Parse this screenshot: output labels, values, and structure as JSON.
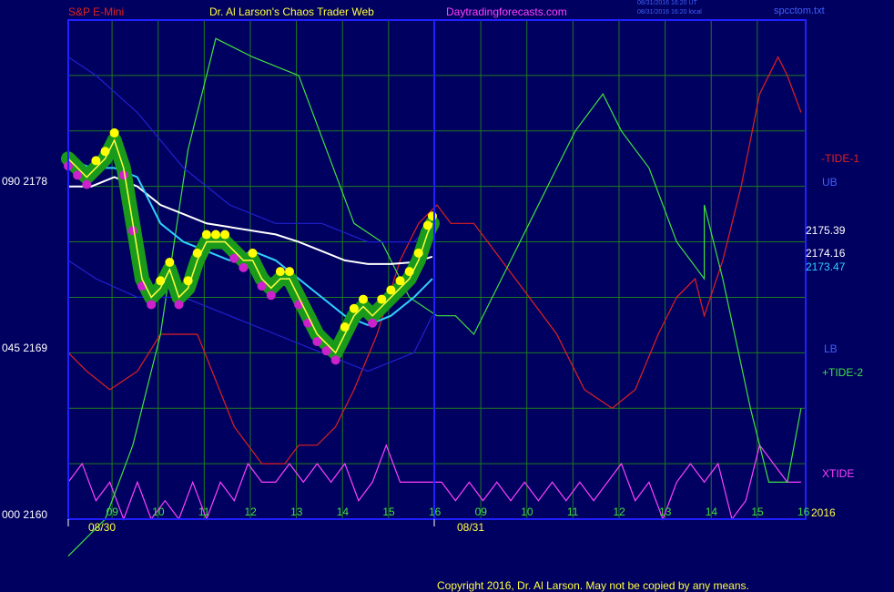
{
  "header": {
    "instrument": "S&P E-Mini",
    "site_title": "Dr. Al Larson's Chaos Trader Web",
    "site_url": "Daytradingforecasts.com",
    "timestamp_ut": "08/31/2016 16:20 UT",
    "timestamp_local": "08/31/2016 16:20 local",
    "file": "spcctom.txt"
  },
  "footer": {
    "copyright": "Copyright 2016, Dr. Al Larson. May not be copied by any means."
  },
  "colors": {
    "background": "#000060",
    "grid": "#1f7a1f",
    "frame": "#2020ff",
    "price": "#ffff40",
    "tide1": "#e02020",
    "tide2": "#40e040",
    "xtide": "#ff40ff",
    "band": "#2020d0",
    "avg_white": "#ffffff",
    "avg_cyan": "#30d0ff"
  },
  "chart_data": {
    "type": "line",
    "ylim": [
      2160,
      2187
    ],
    "y_axis_labels": [
      {
        "value": 2178,
        "text": "090  2178"
      },
      {
        "value": 2169,
        "text": "045  2169"
      },
      {
        "value": 2160,
        "text": "000  2160"
      }
    ],
    "x_ticks": [
      "09",
      "10",
      "11",
      "12",
      "13",
      "14",
      "15",
      "16",
      "09",
      "10",
      "11",
      "12",
      "13",
      "14",
      "15",
      "16"
    ],
    "dates": [
      "08/30",
      "08/31"
    ],
    "year": "2016",
    "right_labels": {
      "tide1": "-TIDE-1",
      "ub": "UB",
      "lb": "LB",
      "tide2": "+TIDE-2",
      "xtide": "XTIDE",
      "price_high": "2175.39",
      "price_last": "2174.16",
      "price_avg": "2173.47"
    },
    "series": [
      {
        "name": "-TIDE-1",
        "key": "tide1",
        "x": [
          0,
          0.4,
          0.9,
          1.5,
          2,
          2.8,
          3.6,
          4.2,
          4.7,
          5,
          5.4,
          5.8,
          6.2,
          6.7,
          7.2,
          7.6,
          8.0,
          8.3,
          8.8,
          9.4,
          10,
          10.6,
          11.2,
          11.8,
          12.3,
          12.8,
          13.2,
          13.6,
          13.8,
          14.2,
          14.6,
          15,
          15.4,
          15.6,
          15.9
        ],
        "values": [
          2169,
          2168,
          2167,
          2168,
          2170,
          2170,
          2165,
          2163,
          2163,
          2164,
          2164,
          2165,
          2167,
          2170,
          2174,
          2176,
          2177,
          2176,
          2176,
          2174,
          2172,
          2170,
          2167,
          2166,
          2167,
          2170,
          2172,
          2173,
          2171,
          2174,
          2178,
          2183,
          2185,
          2184,
          2182
        ]
      },
      {
        "name": "+TIDE-2",
        "key": "tide2",
        "x": [
          0,
          0.8,
          1.4,
          2,
          2.6,
          3.2,
          4,
          5,
          5.6,
          6.2,
          6.8,
          7.4,
          8,
          8.4,
          8.8,
          9.4,
          10,
          10.6,
          11,
          11.6,
          12,
          12.6,
          13.2,
          13.8,
          13.8,
          14.2,
          14.8,
          15.2,
          15.6,
          15.9
        ],
        "values": [
          2158,
          2160,
          2164,
          2170,
          2180,
          2186,
          2185,
          2184,
          2180,
          2176,
          2175,
          2172,
          2171,
          2171,
          2170,
          2173,
          2176,
          2179,
          2181,
          2183,
          2181,
          2179,
          2175,
          2173,
          2177,
          2173,
          2166,
          2162,
          2162,
          2166
        ]
      },
      {
        "name": "UB",
        "key": "ub",
        "x": [
          0,
          0.6,
          1.5,
          2.5,
          3.5,
          4.5,
          5.5,
          6.5,
          7.5,
          7.9
        ],
        "values": [
          2185,
          2184,
          2182,
          2179,
          2177,
          2176,
          2176,
          2175,
          2175,
          2176
        ]
      },
      {
        "name": "LB",
        "key": "lb",
        "x": [
          0,
          0.6,
          1.5,
          2.5,
          3.5,
          4.5,
          5.5,
          6.5,
          7.5,
          7.9
        ],
        "values": [
          2174,
          2173,
          2172,
          2172,
          2171,
          2170,
          2169,
          2168,
          2169,
          2171
        ]
      },
      {
        "name": "XTIDE",
        "key": "xtide",
        "x": [
          0,
          0.3,
          0.6,
          0.9,
          1.2,
          1.5,
          1.8,
          2.1,
          2.4,
          2.7,
          3.0,
          3.3,
          3.6,
          3.9,
          4.2,
          4.5,
          4.8,
          5.1,
          5.4,
          5.7,
          6.0,
          6.3,
          6.6,
          6.9,
          7.2,
          7.5,
          7.8,
          8.1,
          8.4,
          8.7,
          9.0,
          9.3,
          9.6,
          9.9,
          10.2,
          10.5,
          10.8,
          11.1,
          11.4,
          11.7,
          12.0,
          12.3,
          12.6,
          12.9,
          13.2,
          13.5,
          13.8,
          14.1,
          14.4,
          14.7,
          15.0,
          15.3,
          15.6,
          15.9
        ],
        "values": [
          2162,
          2163,
          2161,
          2162,
          2160,
          2162,
          2160,
          2161,
          2160,
          2162,
          2160,
          2162,
          2161,
          2163,
          2162,
          2162,
          2163,
          2162,
          2163,
          2162,
          2163,
          2161,
          2162,
          2164,
          2162,
          2162,
          2162,
          2162,
          2161,
          2162,
          2161,
          2162,
          2161,
          2162,
          2161,
          2162,
          2161,
          2162,
          2161,
          2162,
          2163,
          2161,
          2162,
          2160,
          2162,
          2163,
          2162,
          2163,
          2160,
          2161,
          2164,
          2163,
          2162,
          2162
        ]
      },
      {
        "name": "Price",
        "key": "price",
        "x": [
          0,
          0.2,
          0.4,
          0.6,
          0.8,
          1.0,
          1.2,
          1.4,
          1.6,
          1.8,
          2.0,
          2.2,
          2.4,
          2.6,
          2.8,
          3.0,
          3.2,
          3.4,
          3.6,
          3.8,
          4.0,
          4.2,
          4.4,
          4.6,
          4.8,
          5.0,
          5.2,
          5.4,
          5.6,
          5.8,
          6.0,
          6.2,
          6.4,
          6.6,
          6.8,
          7.0,
          7.2,
          7.4,
          7.6,
          7.8,
          7.9
        ],
        "values": [
          2179.5,
          2179,
          2178.5,
          2179,
          2179.5,
          2180.5,
          2179,
          2176,
          2173,
          2172,
          2172.5,
          2173.5,
          2172,
          2172.5,
          2174,
          2175,
          2175,
          2175,
          2174.5,
          2174,
          2174,
          2173,
          2172.5,
          2173,
          2173,
          2172,
          2171,
          2170,
          2169.5,
          2169,
          2170,
          2171,
          2171.5,
          2171,
          2171.5,
          2172,
          2172.5,
          2173,
          2174,
          2175.5,
          2176
        ]
      },
      {
        "name": "Average (white)",
        "key": "avg_white",
        "x": [
          0,
          0.5,
          1,
          1.5,
          2,
          2.5,
          3,
          3.5,
          4,
          4.5,
          5,
          5.5,
          6,
          6.5,
          7,
          7.5,
          7.9
        ],
        "values": [
          2178,
          2178,
          2178.5,
          2178,
          2177,
          2176.5,
          2176,
          2175.8,
          2175.6,
          2175.4,
          2175,
          2174.5,
          2174,
          2173.8,
          2173.8,
          2173.9,
          2174.2
        ]
      },
      {
        "name": "Average (cyan)",
        "key": "avg_cyan",
        "x": [
          0,
          0.5,
          1,
          1.5,
          2,
          2.5,
          3,
          3.5,
          4,
          4.5,
          5,
          5.5,
          6,
          6.5,
          7,
          7.5,
          7.9
        ],
        "values": [
          2179.5,
          2179,
          2179,
          2178.5,
          2176,
          2175,
          2174.5,
          2174,
          2174.5,
          2174,
          2173,
          2172,
          2171,
          2170.5,
          2171,
          2172,
          2173
        ]
      }
    ]
  }
}
